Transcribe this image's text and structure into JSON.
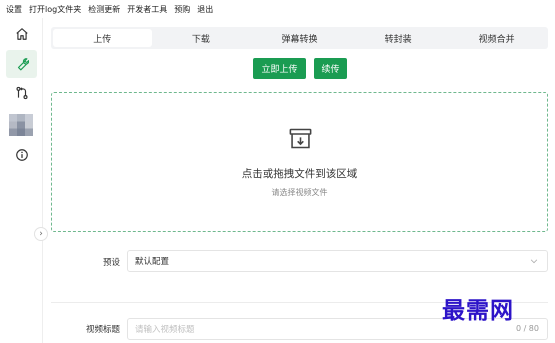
{
  "menu": {
    "items": [
      "设置",
      "打开log文件夹",
      "检测更新",
      "开发者工具",
      "预购",
      "退出"
    ]
  },
  "sidebar": {
    "items": [
      {
        "icon": "home-icon"
      },
      {
        "icon": "wrench-icon",
        "active": true
      },
      {
        "icon": "git-compare-icon"
      },
      {
        "icon": "avatar"
      },
      {
        "icon": "info-icon"
      }
    ],
    "collapse_glyph": "›"
  },
  "tabs": [
    {
      "label": "上传",
      "active": true
    },
    {
      "label": "下载"
    },
    {
      "label": "弹幕转换"
    },
    {
      "label": "转封装"
    },
    {
      "label": "视频合并"
    }
  ],
  "actions": {
    "upload_now": "立即上传",
    "resume": "续传"
  },
  "dropzone": {
    "title": "点击或拖拽文件到该区域",
    "subtitle": "请选择视频文件"
  },
  "form": {
    "preset_label": "预设",
    "preset_value": "默认配置",
    "title_label": "视频标题",
    "title_placeholder": "请输入视频标题",
    "title_counter": "0 / 80"
  },
  "watermark": "最需网",
  "colors": {
    "accent": "#1a9c52",
    "active_side_bg": "#e9f3ec",
    "dropzone_border": "#6fb88e"
  }
}
